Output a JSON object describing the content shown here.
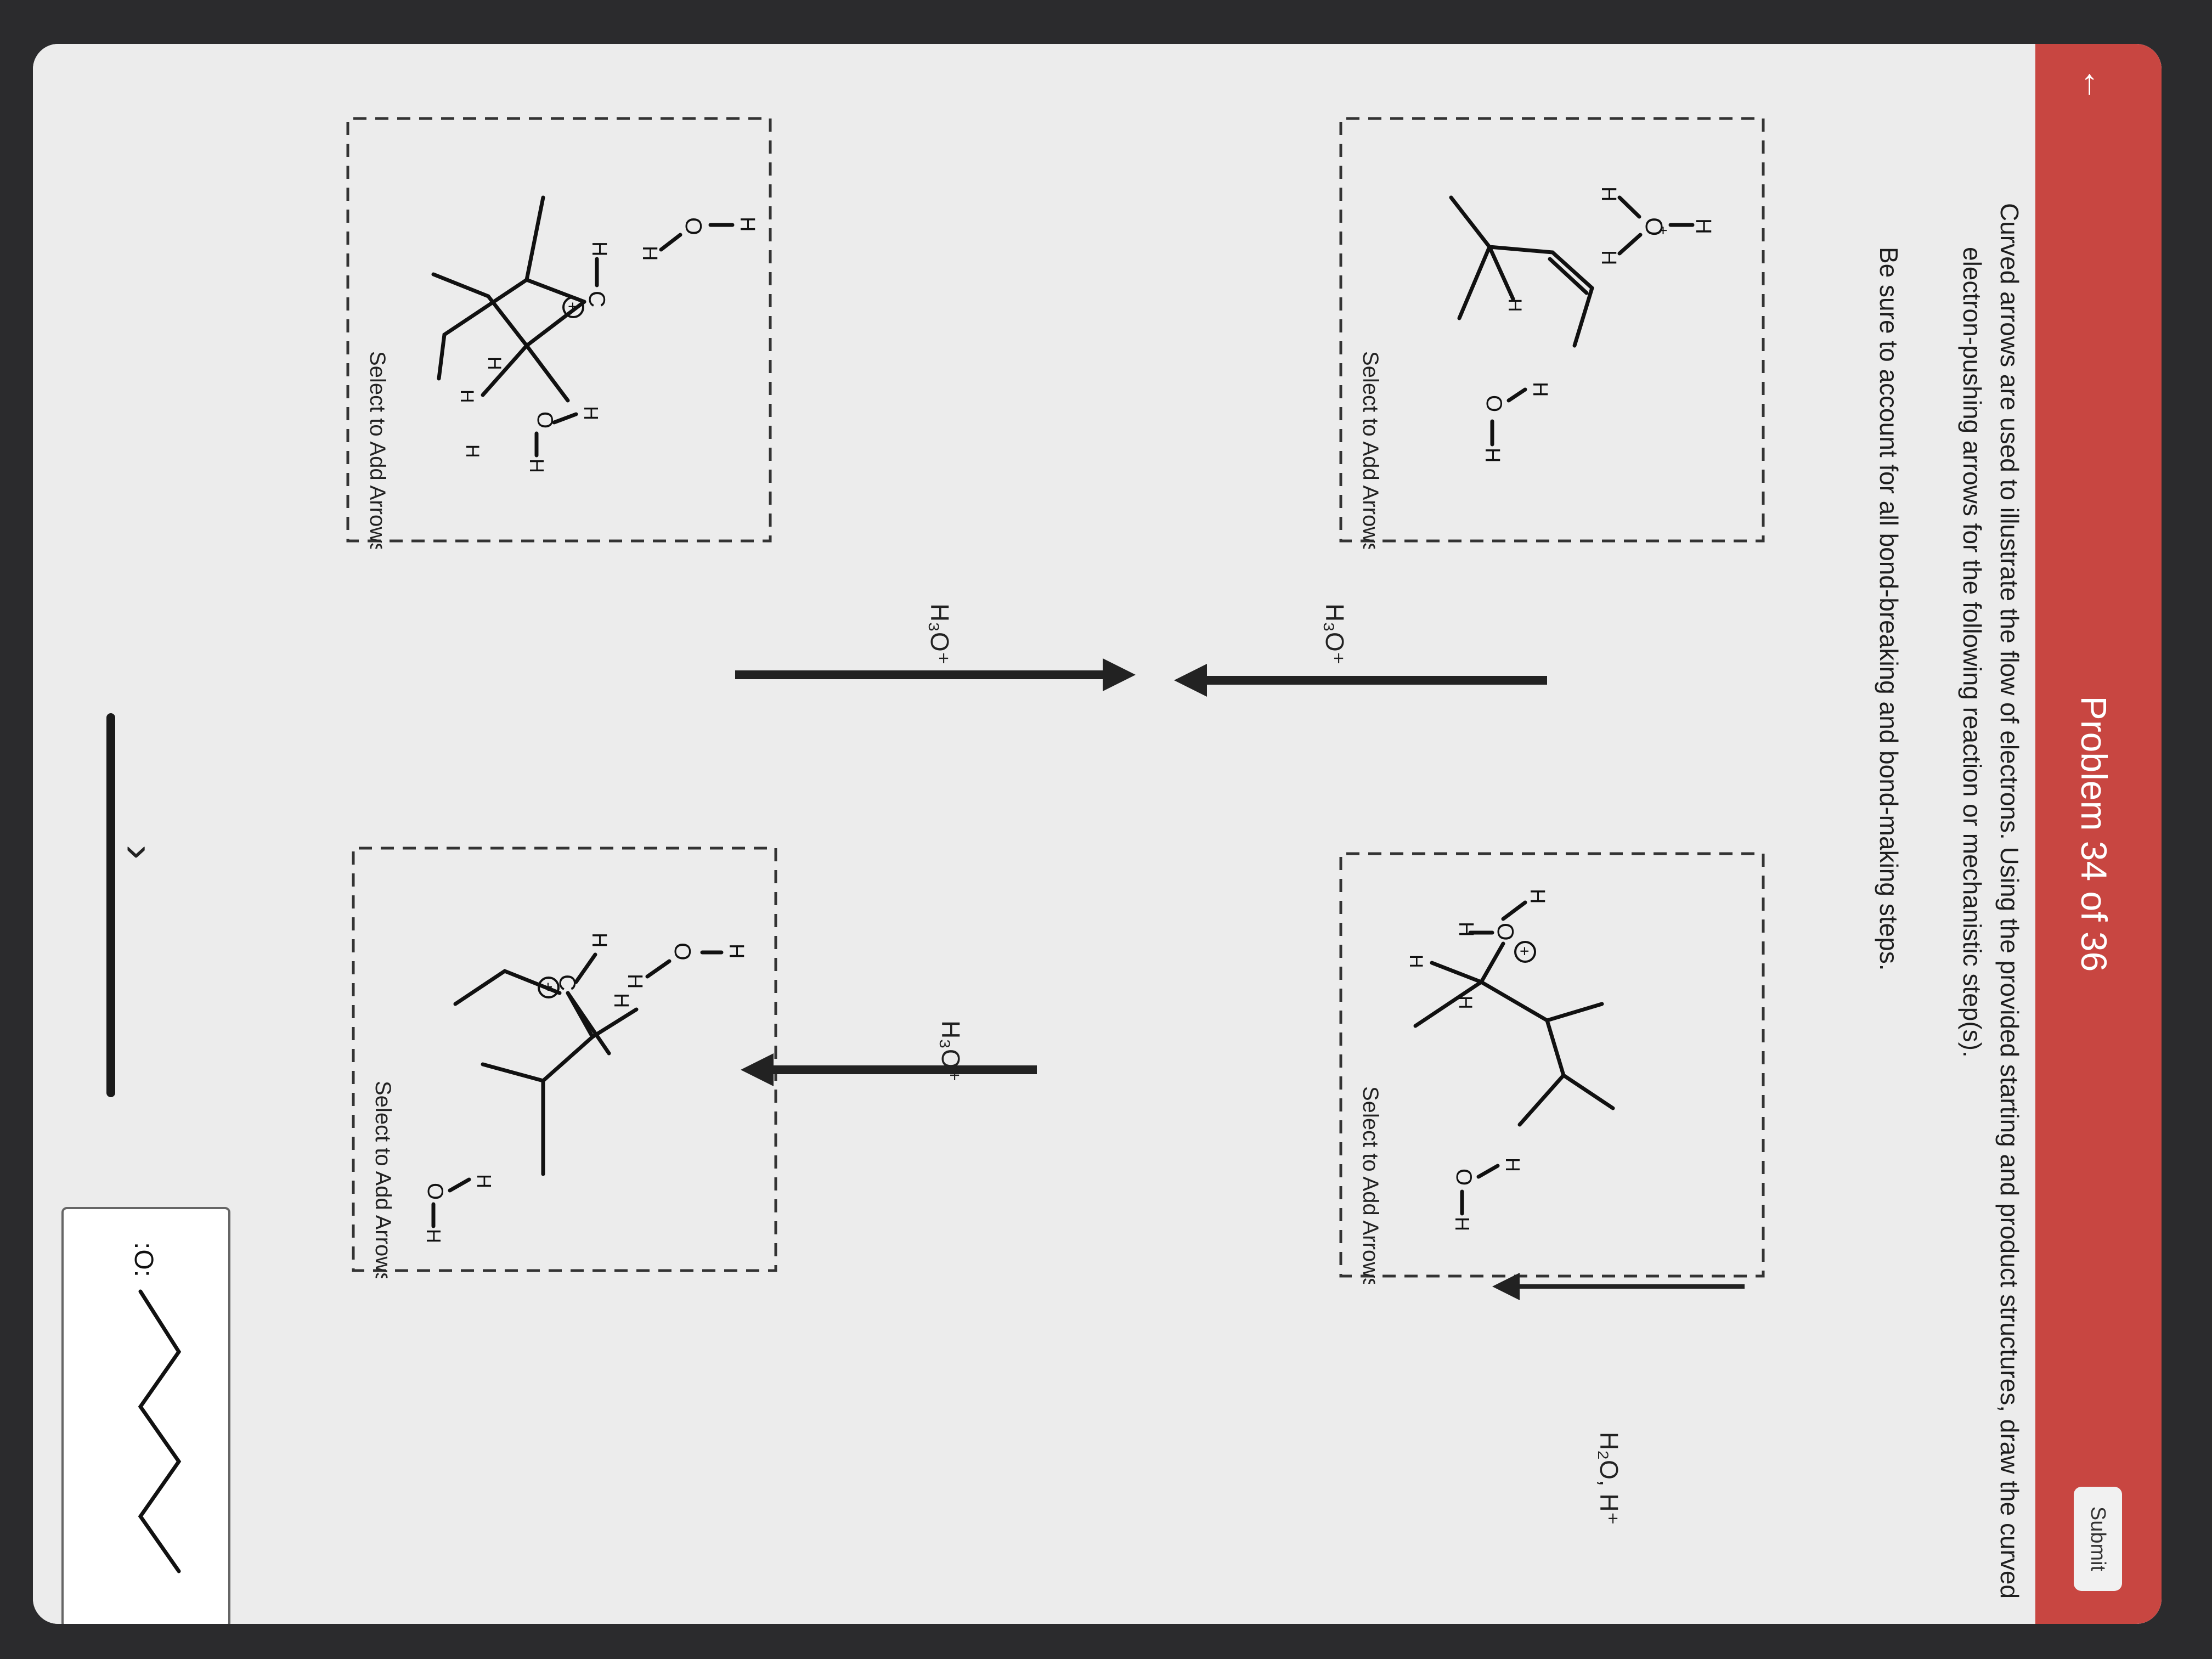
{
  "header": {
    "back_icon": "back-arrow-icon",
    "title": "Problem 34 of 36",
    "submit_label": "Submit"
  },
  "instructions": {
    "line1": "Curved arrows are used to illustrate the flow of electrons. Using the provided starting and product structures, draw the curved",
    "line2": "electron-pushing arrows for the following reaction or mechanistic step(s).",
    "line3": "Be sure to account for all bond-breaking and bond-making steps."
  },
  "panels": {
    "prompt": "Select to Add Arrows"
  },
  "atoms": {
    "h": "H",
    "o": "O",
    "c": "C",
    "plus": "+",
    "lp": ":"
  },
  "reagents": {
    "step1": "H₃O⁺",
    "step2": "H₃O⁺",
    "step3": "H₃O⁺",
    "overall": "H₂O, H⁺"
  },
  "final_box": {
    "o_label": ":O:"
  },
  "nav": {
    "next_icon": "chevron-right-icon"
  }
}
